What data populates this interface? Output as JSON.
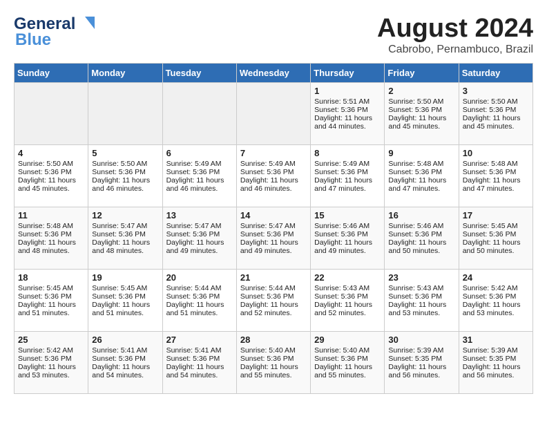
{
  "header": {
    "logo_line1": "General",
    "logo_line2": "Blue",
    "month_year": "August 2024",
    "location": "Cabrobo, Pernambuco, Brazil"
  },
  "days_of_week": [
    "Sunday",
    "Monday",
    "Tuesday",
    "Wednesday",
    "Thursday",
    "Friday",
    "Saturday"
  ],
  "weeks": [
    [
      {
        "day": "",
        "empty": true
      },
      {
        "day": "",
        "empty": true
      },
      {
        "day": "",
        "empty": true
      },
      {
        "day": "",
        "empty": true
      },
      {
        "day": "1",
        "sunrise": "5:51 AM",
        "sunset": "5:36 PM",
        "daylight": "11 hours and 44 minutes."
      },
      {
        "day": "2",
        "sunrise": "5:50 AM",
        "sunset": "5:36 PM",
        "daylight": "11 hours and 45 minutes."
      },
      {
        "day": "3",
        "sunrise": "5:50 AM",
        "sunset": "5:36 PM",
        "daylight": "11 hours and 45 minutes."
      }
    ],
    [
      {
        "day": "4",
        "sunrise": "5:50 AM",
        "sunset": "5:36 PM",
        "daylight": "11 hours and 45 minutes."
      },
      {
        "day": "5",
        "sunrise": "5:50 AM",
        "sunset": "5:36 PM",
        "daylight": "11 hours and 46 minutes."
      },
      {
        "day": "6",
        "sunrise": "5:49 AM",
        "sunset": "5:36 PM",
        "daylight": "11 hours and 46 minutes."
      },
      {
        "day": "7",
        "sunrise": "5:49 AM",
        "sunset": "5:36 PM",
        "daylight": "11 hours and 46 minutes."
      },
      {
        "day": "8",
        "sunrise": "5:49 AM",
        "sunset": "5:36 PM",
        "daylight": "11 hours and 47 minutes."
      },
      {
        "day": "9",
        "sunrise": "5:48 AM",
        "sunset": "5:36 PM",
        "daylight": "11 hours and 47 minutes."
      },
      {
        "day": "10",
        "sunrise": "5:48 AM",
        "sunset": "5:36 PM",
        "daylight": "11 hours and 47 minutes."
      }
    ],
    [
      {
        "day": "11",
        "sunrise": "5:48 AM",
        "sunset": "5:36 PM",
        "daylight": "11 hours and 48 minutes."
      },
      {
        "day": "12",
        "sunrise": "5:47 AM",
        "sunset": "5:36 PM",
        "daylight": "11 hours and 48 minutes."
      },
      {
        "day": "13",
        "sunrise": "5:47 AM",
        "sunset": "5:36 PM",
        "daylight": "11 hours and 49 minutes."
      },
      {
        "day": "14",
        "sunrise": "5:47 AM",
        "sunset": "5:36 PM",
        "daylight": "11 hours and 49 minutes."
      },
      {
        "day": "15",
        "sunrise": "5:46 AM",
        "sunset": "5:36 PM",
        "daylight": "11 hours and 49 minutes."
      },
      {
        "day": "16",
        "sunrise": "5:46 AM",
        "sunset": "5:36 PM",
        "daylight": "11 hours and 50 minutes."
      },
      {
        "day": "17",
        "sunrise": "5:45 AM",
        "sunset": "5:36 PM",
        "daylight": "11 hours and 50 minutes."
      }
    ],
    [
      {
        "day": "18",
        "sunrise": "5:45 AM",
        "sunset": "5:36 PM",
        "daylight": "11 hours and 51 minutes."
      },
      {
        "day": "19",
        "sunrise": "5:45 AM",
        "sunset": "5:36 PM",
        "daylight": "11 hours and 51 minutes."
      },
      {
        "day": "20",
        "sunrise": "5:44 AM",
        "sunset": "5:36 PM",
        "daylight": "11 hours and 51 minutes."
      },
      {
        "day": "21",
        "sunrise": "5:44 AM",
        "sunset": "5:36 PM",
        "daylight": "11 hours and 52 minutes."
      },
      {
        "day": "22",
        "sunrise": "5:43 AM",
        "sunset": "5:36 PM",
        "daylight": "11 hours and 52 minutes."
      },
      {
        "day": "23",
        "sunrise": "5:43 AM",
        "sunset": "5:36 PM",
        "daylight": "11 hours and 53 minutes."
      },
      {
        "day": "24",
        "sunrise": "5:42 AM",
        "sunset": "5:36 PM",
        "daylight": "11 hours and 53 minutes."
      }
    ],
    [
      {
        "day": "25",
        "sunrise": "5:42 AM",
        "sunset": "5:36 PM",
        "daylight": "11 hours and 53 minutes."
      },
      {
        "day": "26",
        "sunrise": "5:41 AM",
        "sunset": "5:36 PM",
        "daylight": "11 hours and 54 minutes."
      },
      {
        "day": "27",
        "sunrise": "5:41 AM",
        "sunset": "5:36 PM",
        "daylight": "11 hours and 54 minutes."
      },
      {
        "day": "28",
        "sunrise": "5:40 AM",
        "sunset": "5:36 PM",
        "daylight": "11 hours and 55 minutes."
      },
      {
        "day": "29",
        "sunrise": "5:40 AM",
        "sunset": "5:36 PM",
        "daylight": "11 hours and 55 minutes."
      },
      {
        "day": "30",
        "sunrise": "5:39 AM",
        "sunset": "5:35 PM",
        "daylight": "11 hours and 56 minutes."
      },
      {
        "day": "31",
        "sunrise": "5:39 AM",
        "sunset": "5:35 PM",
        "daylight": "11 hours and 56 minutes."
      }
    ]
  ],
  "labels": {
    "sunrise": "Sunrise:",
    "sunset": "Sunset:",
    "daylight": "Daylight:"
  }
}
